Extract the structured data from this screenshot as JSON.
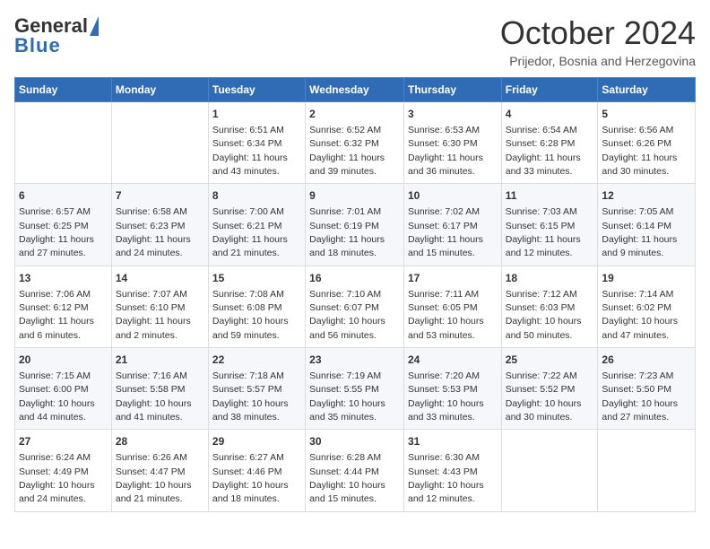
{
  "header": {
    "logo_general": "General",
    "logo_blue": "Blue",
    "month": "October 2024",
    "location": "Prijedor, Bosnia and Herzegovina"
  },
  "days_of_week": [
    "Sunday",
    "Monday",
    "Tuesday",
    "Wednesday",
    "Thursday",
    "Friday",
    "Saturday"
  ],
  "weeks": [
    [
      {
        "day": "",
        "sunrise": "",
        "sunset": "",
        "daylight": ""
      },
      {
        "day": "",
        "sunrise": "",
        "sunset": "",
        "daylight": ""
      },
      {
        "day": "1",
        "sunrise": "Sunrise: 6:51 AM",
        "sunset": "Sunset: 6:34 PM",
        "daylight": "Daylight: 11 hours and 43 minutes."
      },
      {
        "day": "2",
        "sunrise": "Sunrise: 6:52 AM",
        "sunset": "Sunset: 6:32 PM",
        "daylight": "Daylight: 11 hours and 39 minutes."
      },
      {
        "day": "3",
        "sunrise": "Sunrise: 6:53 AM",
        "sunset": "Sunset: 6:30 PM",
        "daylight": "Daylight: 11 hours and 36 minutes."
      },
      {
        "day": "4",
        "sunrise": "Sunrise: 6:54 AM",
        "sunset": "Sunset: 6:28 PM",
        "daylight": "Daylight: 11 hours and 33 minutes."
      },
      {
        "day": "5",
        "sunrise": "Sunrise: 6:56 AM",
        "sunset": "Sunset: 6:26 PM",
        "daylight": "Daylight: 11 hours and 30 minutes."
      }
    ],
    [
      {
        "day": "6",
        "sunrise": "Sunrise: 6:57 AM",
        "sunset": "Sunset: 6:25 PM",
        "daylight": "Daylight: 11 hours and 27 minutes."
      },
      {
        "day": "7",
        "sunrise": "Sunrise: 6:58 AM",
        "sunset": "Sunset: 6:23 PM",
        "daylight": "Daylight: 11 hours and 24 minutes."
      },
      {
        "day": "8",
        "sunrise": "Sunrise: 7:00 AM",
        "sunset": "Sunset: 6:21 PM",
        "daylight": "Daylight: 11 hours and 21 minutes."
      },
      {
        "day": "9",
        "sunrise": "Sunrise: 7:01 AM",
        "sunset": "Sunset: 6:19 PM",
        "daylight": "Daylight: 11 hours and 18 minutes."
      },
      {
        "day": "10",
        "sunrise": "Sunrise: 7:02 AM",
        "sunset": "Sunset: 6:17 PM",
        "daylight": "Daylight: 11 hours and 15 minutes."
      },
      {
        "day": "11",
        "sunrise": "Sunrise: 7:03 AM",
        "sunset": "Sunset: 6:15 PM",
        "daylight": "Daylight: 11 hours and 12 minutes."
      },
      {
        "day": "12",
        "sunrise": "Sunrise: 7:05 AM",
        "sunset": "Sunset: 6:14 PM",
        "daylight": "Daylight: 11 hours and 9 minutes."
      }
    ],
    [
      {
        "day": "13",
        "sunrise": "Sunrise: 7:06 AM",
        "sunset": "Sunset: 6:12 PM",
        "daylight": "Daylight: 11 hours and 6 minutes."
      },
      {
        "day": "14",
        "sunrise": "Sunrise: 7:07 AM",
        "sunset": "Sunset: 6:10 PM",
        "daylight": "Daylight: 11 hours and 2 minutes."
      },
      {
        "day": "15",
        "sunrise": "Sunrise: 7:08 AM",
        "sunset": "Sunset: 6:08 PM",
        "daylight": "Daylight: 10 hours and 59 minutes."
      },
      {
        "day": "16",
        "sunrise": "Sunrise: 7:10 AM",
        "sunset": "Sunset: 6:07 PM",
        "daylight": "Daylight: 10 hours and 56 minutes."
      },
      {
        "day": "17",
        "sunrise": "Sunrise: 7:11 AM",
        "sunset": "Sunset: 6:05 PM",
        "daylight": "Daylight: 10 hours and 53 minutes."
      },
      {
        "day": "18",
        "sunrise": "Sunrise: 7:12 AM",
        "sunset": "Sunset: 6:03 PM",
        "daylight": "Daylight: 10 hours and 50 minutes."
      },
      {
        "day": "19",
        "sunrise": "Sunrise: 7:14 AM",
        "sunset": "Sunset: 6:02 PM",
        "daylight": "Daylight: 10 hours and 47 minutes."
      }
    ],
    [
      {
        "day": "20",
        "sunrise": "Sunrise: 7:15 AM",
        "sunset": "Sunset: 6:00 PM",
        "daylight": "Daylight: 10 hours and 44 minutes."
      },
      {
        "day": "21",
        "sunrise": "Sunrise: 7:16 AM",
        "sunset": "Sunset: 5:58 PM",
        "daylight": "Daylight: 10 hours and 41 minutes."
      },
      {
        "day": "22",
        "sunrise": "Sunrise: 7:18 AM",
        "sunset": "Sunset: 5:57 PM",
        "daylight": "Daylight: 10 hours and 38 minutes."
      },
      {
        "day": "23",
        "sunrise": "Sunrise: 7:19 AM",
        "sunset": "Sunset: 5:55 PM",
        "daylight": "Daylight: 10 hours and 35 minutes."
      },
      {
        "day": "24",
        "sunrise": "Sunrise: 7:20 AM",
        "sunset": "Sunset: 5:53 PM",
        "daylight": "Daylight: 10 hours and 33 minutes."
      },
      {
        "day": "25",
        "sunrise": "Sunrise: 7:22 AM",
        "sunset": "Sunset: 5:52 PM",
        "daylight": "Daylight: 10 hours and 30 minutes."
      },
      {
        "day": "26",
        "sunrise": "Sunrise: 7:23 AM",
        "sunset": "Sunset: 5:50 PM",
        "daylight": "Daylight: 10 hours and 27 minutes."
      }
    ],
    [
      {
        "day": "27",
        "sunrise": "Sunrise: 6:24 AM",
        "sunset": "Sunset: 4:49 PM",
        "daylight": "Daylight: 10 hours and 24 minutes."
      },
      {
        "day": "28",
        "sunrise": "Sunrise: 6:26 AM",
        "sunset": "Sunset: 4:47 PM",
        "daylight": "Daylight: 10 hours and 21 minutes."
      },
      {
        "day": "29",
        "sunrise": "Sunrise: 6:27 AM",
        "sunset": "Sunset: 4:46 PM",
        "daylight": "Daylight: 10 hours and 18 minutes."
      },
      {
        "day": "30",
        "sunrise": "Sunrise: 6:28 AM",
        "sunset": "Sunset: 4:44 PM",
        "daylight": "Daylight: 10 hours and 15 minutes."
      },
      {
        "day": "31",
        "sunrise": "Sunrise: 6:30 AM",
        "sunset": "Sunset: 4:43 PM",
        "daylight": "Daylight: 10 hours and 12 minutes."
      },
      {
        "day": "",
        "sunrise": "",
        "sunset": "",
        "daylight": ""
      },
      {
        "day": "",
        "sunrise": "",
        "sunset": "",
        "daylight": ""
      }
    ]
  ]
}
